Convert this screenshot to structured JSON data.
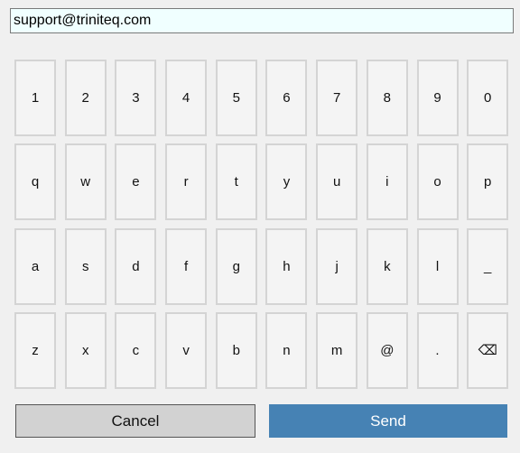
{
  "input": {
    "value": "support@triniteq.com"
  },
  "keyboard": {
    "rows": [
      [
        "1",
        "2",
        "3",
        "4",
        "5",
        "6",
        "7",
        "8",
        "9",
        "0"
      ],
      [
        "q",
        "w",
        "e",
        "r",
        "t",
        "y",
        "u",
        "i",
        "o",
        "p"
      ],
      [
        "a",
        "s",
        "d",
        "f",
        "g",
        "h",
        "j",
        "k",
        "l",
        "_"
      ],
      [
        "z",
        "x",
        "c",
        "v",
        "b",
        "n",
        "m",
        "@",
        ".",
        "⌫"
      ]
    ]
  },
  "buttons": {
    "cancel_label": "Cancel",
    "send_label": "Send"
  },
  "colors": {
    "send_background": "#4682b4",
    "input_background": "#f0ffff"
  }
}
